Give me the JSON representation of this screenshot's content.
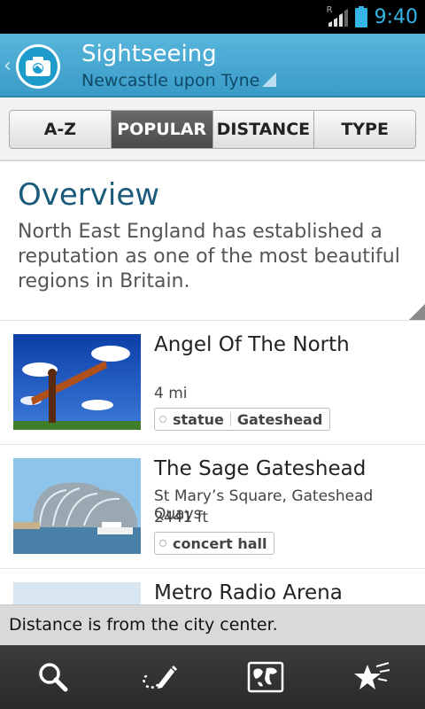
{
  "status_bar": {
    "time": "9:40",
    "network_label": "R"
  },
  "action_bar": {
    "title": "Sightseeing",
    "subtitle": "Newcastle upon Tyne"
  },
  "tabs": [
    {
      "label": "A-Z",
      "active": false
    },
    {
      "label": "POPULAR",
      "active": true
    },
    {
      "label": "DISTANCE",
      "active": false
    },
    {
      "label": "TYPE",
      "active": false
    }
  ],
  "overview": {
    "title": "Overview",
    "text": "North East England has established a reputation as one of the most beautiful regions in Britain."
  },
  "items": [
    {
      "title": "Angel Of The North",
      "address": "",
      "distance": "4 mi",
      "tags": [
        "statue",
        "Gateshead"
      ]
    },
    {
      "title": "The Sage Gateshead",
      "address": "St Mary’s Square, Gateshead Quays",
      "distance": "2441 ft",
      "tags": [
        "concert hall"
      ]
    },
    {
      "title": "Metro Radio Arena",
      "address": "",
      "distance": "",
      "tags": []
    }
  ],
  "toast": {
    "text": "Distance is from the city center."
  },
  "bottom_bar": {
    "icons": [
      "search-icon",
      "edit-route-icon",
      "map-icon",
      "favorites-icon"
    ]
  },
  "colors": {
    "accent": "#3a9bc8",
    "title_blue": "#1a5a7a",
    "status_time": "#33b5e5"
  }
}
